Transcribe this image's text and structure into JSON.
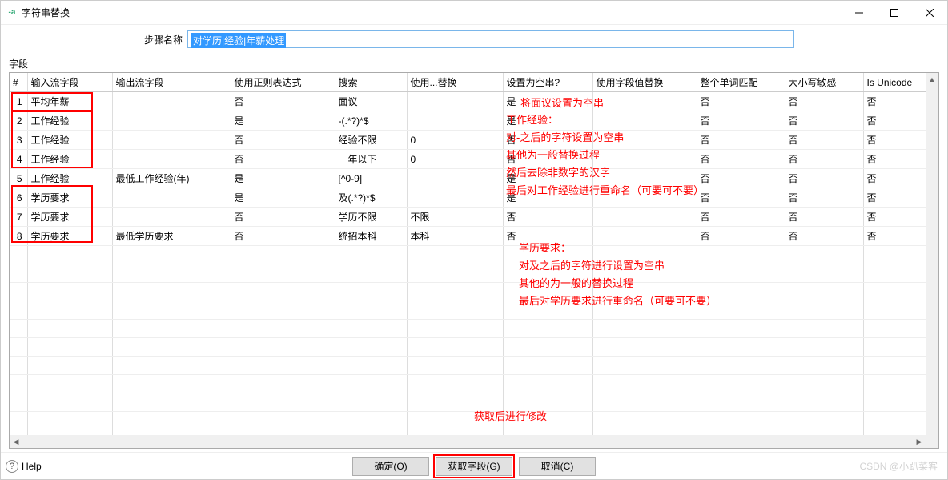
{
  "window": {
    "title": "字符串替换"
  },
  "step": {
    "label": "步骤名称",
    "value": "对学历|经验|年薪处理"
  },
  "section_label": "字段",
  "grid": {
    "headers": [
      "#",
      "输入流字段",
      "输出流字段",
      "使用正则表达式",
      "搜索",
      "使用...替换",
      "设置为空串?",
      "使用字段值替换",
      "整个单词匹配",
      "大小写敏感",
      "Is Unicode"
    ],
    "rows": [
      {
        "n": "1",
        "in": "平均年薪",
        "out": "",
        "regex": "否",
        "search": "面议",
        "repl": "",
        "empty": "是",
        "fieldrepl": "",
        "word": "否",
        "case": "否",
        "uni": "否"
      },
      {
        "n": "2",
        "in": "工作经验",
        "out": "",
        "regex": "是",
        "search": "-(.*?)*$",
        "repl": "",
        "empty": "是",
        "fieldrepl": "",
        "word": "否",
        "case": "否",
        "uni": "否"
      },
      {
        "n": "3",
        "in": "工作经验",
        "out": "",
        "regex": "否",
        "search": "经验不限",
        "repl": "0",
        "empty": "否",
        "fieldrepl": "",
        "word": "否",
        "case": "否",
        "uni": "否"
      },
      {
        "n": "4",
        "in": "工作经验",
        "out": "",
        "regex": "否",
        "search": "一年以下",
        "repl": "0",
        "empty": "否",
        "fieldrepl": "",
        "word": "否",
        "case": "否",
        "uni": "否"
      },
      {
        "n": "5",
        "in": "工作经验",
        "out": "最低工作经验(年)",
        "regex": "是",
        "search": "[^0-9]",
        "repl": "",
        "empty": "是",
        "fieldrepl": "",
        "word": "否",
        "case": "否",
        "uni": "否"
      },
      {
        "n": "6",
        "in": "学历要求",
        "out": "",
        "regex": "是",
        "search": "及(.*?)*$",
        "repl": "",
        "empty": "是",
        "fieldrepl": "",
        "word": "否",
        "case": "否",
        "uni": "否"
      },
      {
        "n": "7",
        "in": "学历要求",
        "out": "",
        "regex": "否",
        "search": "学历不限",
        "repl": "不限",
        "empty": "否",
        "fieldrepl": "",
        "word": "否",
        "case": "否",
        "uni": "否"
      },
      {
        "n": "8",
        "in": "学历要求",
        "out": "最低学历要求",
        "regex": "否",
        "search": "统招本科",
        "repl": "本科",
        "empty": "否",
        "fieldrepl": "",
        "word": "否",
        "case": "否",
        "uni": "否"
      }
    ]
  },
  "annotations": {
    "a1": "将面议设置为空串",
    "a2": "工作经验：\n对-之后的字符设置为空串\n其他为一般替换过程\n然后去除非数字的汉字\n最后对工作经验进行重命名（可要可不要）",
    "a3": "学历要求：\n对及之后的字符进行设置为空串\n其他的为一般的替换过程\n最后对学历要求进行重命名（可要可不要）",
    "a4": "获取后进行修改"
  },
  "footer": {
    "help": "Help",
    "ok": "确定(O)",
    "get": "获取字段(G)",
    "cancel": "取消(C)"
  },
  "watermark": "CSDN @小趴菜客"
}
